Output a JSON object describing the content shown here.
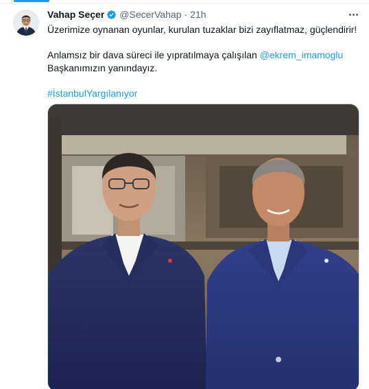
{
  "tweet": {
    "author": {
      "display_name": "Vahap Seçer",
      "handle": "@SecerVahap",
      "verified_icon": "verified-badge-icon"
    },
    "separator": "·",
    "timestamp": "21h",
    "more_icon": "more-options-icon",
    "text": {
      "line1": "Üzerimize oynanan oyunlar, kurulan tuzaklar bizi zayıflatmaz, güçlendirir!",
      "line2_prefix": "Anlamsız bir dava süreci ile yıpratılmaya çalışılan ",
      "mention": "@ekrem_imamoglu",
      "line3": "Başkanımızın yanındayız.",
      "hashtag": "#İstanbulYargılanıyor"
    },
    "media": {
      "description_icon": "photo-two-men-in-suits"
    }
  },
  "colors": {
    "accent": "#1d9bf0",
    "text": "#0f1419",
    "secondary": "#536471"
  }
}
